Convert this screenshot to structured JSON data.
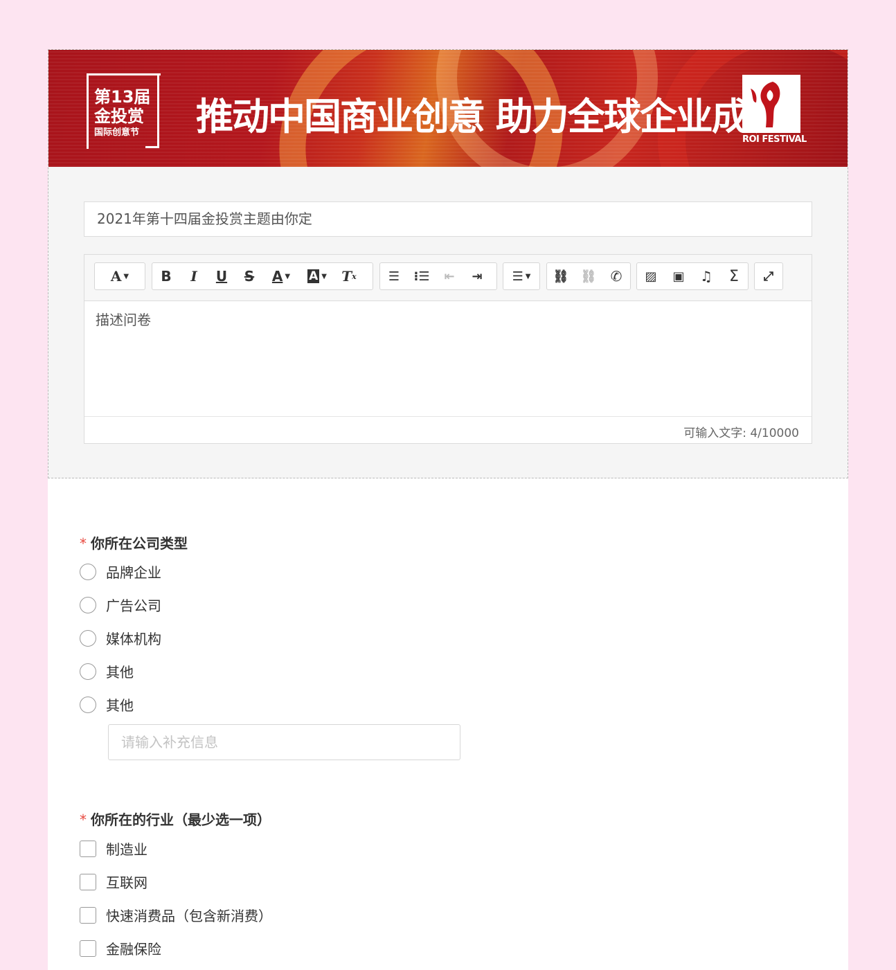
{
  "banner": {
    "badge_line1": "第13届",
    "badge_line2": "金投赏",
    "badge_line3": "国际创意节",
    "slogan": "推动中国商业创意 助力全球企业成长",
    "logo_text": "ROI FESTIVAL"
  },
  "survey": {
    "title": "2021年第十四届金投赏主题由你定",
    "description": "描述问卷",
    "counter": "可输入文字: 4/10000"
  },
  "toolbar": {
    "groups": [
      [
        "font-icon"
      ],
      [
        "bold-icon",
        "italic-icon",
        "underline-icon",
        "strikethrough-icon",
        "font-color-icon",
        "highlight-icon",
        "clear-format-icon"
      ],
      [
        "ordered-list-icon",
        "unordered-list-icon",
        "outdent-icon",
        "indent-icon"
      ],
      [
        "align-icon"
      ],
      [
        "link-icon",
        "unlink-icon",
        "phone-icon"
      ],
      [
        "image-icon",
        "video-icon",
        "music-icon",
        "formula-icon"
      ],
      [
        "fullscreen-icon"
      ]
    ]
  },
  "q1": {
    "required_mark": "*",
    "title": "你所在公司类型",
    "options": [
      "品牌企业",
      "广告公司",
      "媒体机构",
      "其他",
      "其他"
    ],
    "other_placeholder": "请输入补充信息"
  },
  "q2": {
    "required_mark": "*",
    "title": "你所在的行业（最少选一项）",
    "options": [
      "制造业",
      "互联网",
      "快速消费品（包含新消费）",
      "金融保险"
    ]
  },
  "colors": {
    "page_bg": "#fde4f1",
    "required": "#e8493f",
    "banner_red": "#b3161c"
  }
}
